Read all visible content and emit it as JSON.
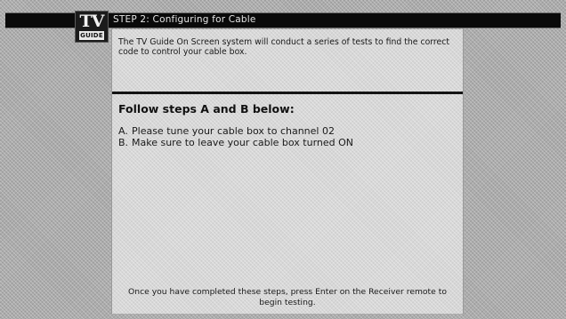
{
  "header": {
    "title": "STEP 2: Configuring for Cable",
    "logo": {
      "top": "TV",
      "bottom": "GUIDE"
    }
  },
  "content": {
    "intro": "The TV Guide On Screen system will conduct a series of tests to find the correct code to control your cable box.",
    "heading": "Follow steps A and B below:",
    "steps": [
      {
        "letter": "A.",
        "text": "Please tune your cable box to channel 02"
      },
      {
        "letter": "B.",
        "text": "Make sure to leave your cable box turned ON"
      }
    ],
    "footer": "Once you have completed these steps, press Enter on the Receiver remote to begin testing."
  },
  "colors": {
    "title_bar": "#0a0a0a",
    "panel": "#d7d7d7",
    "background": "#ababab"
  }
}
